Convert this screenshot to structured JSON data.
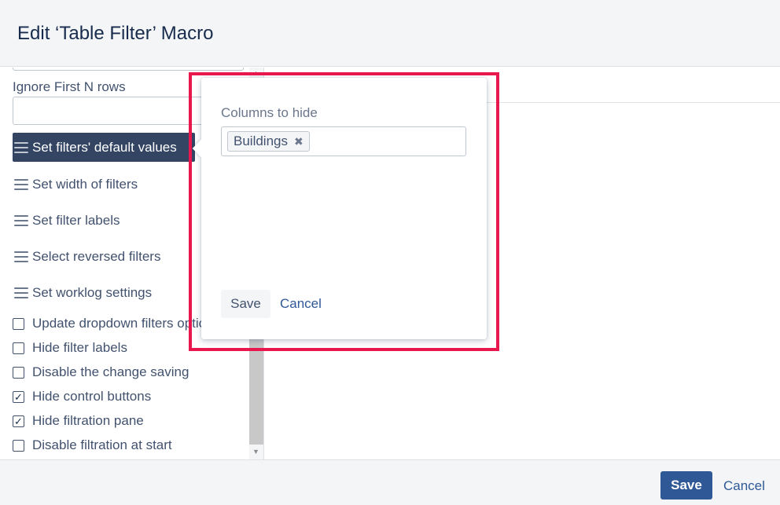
{
  "dialog": {
    "title": "Edit ‘Table Filter’ Macro"
  },
  "form": {
    "ignore_rows_label": "Ignore First N rows",
    "ignore_rows_value": ""
  },
  "menu": {
    "items": [
      {
        "label": "Set filters' default values",
        "active": true
      },
      {
        "label": "Set width of filters",
        "active": false
      },
      {
        "label": "Set filter labels",
        "active": false
      },
      {
        "label": "Select reversed filters",
        "active": false
      },
      {
        "label": "Set worklog settings",
        "active": false
      }
    ]
  },
  "options": {
    "items": [
      {
        "label": "Update dropdown filters options",
        "checked": false
      },
      {
        "label": "Hide filter labels",
        "checked": false
      },
      {
        "label": "Disable the change saving",
        "checked": false
      },
      {
        "label": "Hide control buttons",
        "checked": true
      },
      {
        "label": "Hide filtration pane",
        "checked": true
      },
      {
        "label": "Disable filtration at start",
        "checked": false
      }
    ]
  },
  "popup": {
    "label": "Columns to hide",
    "tags": [
      "Buildings"
    ],
    "tag_remove_glyph": "✖",
    "save_label": "Save",
    "cancel_label": "Cancel"
  },
  "footer": {
    "save_label": "Save",
    "cancel_label": "Cancel"
  },
  "icons": {
    "checkmark": "✓"
  },
  "colors": {
    "accent": "#2f5896",
    "active_menu": "#344563",
    "highlight": "#e8174d"
  }
}
